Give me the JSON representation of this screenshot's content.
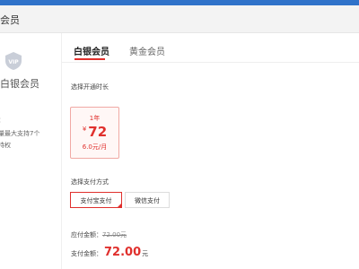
{
  "header": {
    "title": "会员"
  },
  "sidebar": {
    "badge_icon": "vip-shield-icon",
    "title": "白银会员",
    "line1": "：",
    "line2": "量最大支持7个",
    "line3": "特权"
  },
  "tabs": [
    {
      "label": "白银会员",
      "active": true
    },
    {
      "label": "黄金会员",
      "active": false
    }
  ],
  "duration": {
    "label": "选择开通时长",
    "plans": [
      {
        "period": "1年",
        "currency": "¥",
        "price": "72",
        "monthly": "6.0元/月",
        "selected": true
      }
    ]
  },
  "payment": {
    "label": "选择支付方式",
    "methods": [
      {
        "label": "支付宝支付",
        "selected": true
      },
      {
        "label": "微信支付",
        "selected": false
      }
    ]
  },
  "summary": {
    "due_label": "应付金额：",
    "due_value": "72.00元",
    "paid_label": "支付金额：",
    "paid_value": "72.00",
    "paid_unit": "元"
  },
  "colors": {
    "accent": "#e0302d",
    "titlebar": "#2f72c9"
  }
}
